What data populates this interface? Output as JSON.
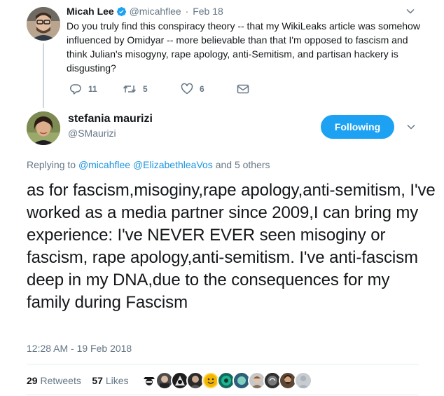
{
  "parent_tweet": {
    "name": "Micah Lee",
    "handle": "@micahflee",
    "separator": "·",
    "date": "Feb 18",
    "text": "Do you truly find this conspiracy theory -- that my WikiLeaks article was somehow influenced by Omidyar -- more believable than that I'm opposed to fascism and think Julian's misogyny, rape apology, anti-Semitism, and partisan hackery is disgusting?",
    "reply_count": "11",
    "retweet_count": "5",
    "like_count": "6",
    "icons": [
      "reply-icon",
      "retweet-icon",
      "like-icon",
      "dm-icon",
      "chevron-down-icon",
      "verified-badge-icon"
    ]
  },
  "tweet": {
    "name": "stefania maurizi",
    "handle": "@SMaurizi",
    "follow_label": "Following",
    "replying_prefix": "Replying to",
    "replying_user1": "@micahflee",
    "replying_user2": "@ElizabethleaVos",
    "replying_suffix": "and 5 others",
    "text": "as for fascism,misoginy,rape apology,anti-semitism, I've worked as a media partner since 2009,I can bring my experience: I've NEVER EVER seen misoginy or fascism, rape apology,anti-semitism. I've anti-fascism deep in my DNA,due to the consequences for my family during Fascism",
    "timestamp": "12:28 AM - 19 Feb 2018",
    "retweets_count": "29",
    "retweets_label": "Retweets",
    "likes_count": "57",
    "likes_label": "Likes"
  },
  "colors": {
    "accent": "#1da1f2",
    "link": "#1b95e0",
    "muted": "#657786",
    "text": "#14171a",
    "divider": "#e6ecf0"
  }
}
